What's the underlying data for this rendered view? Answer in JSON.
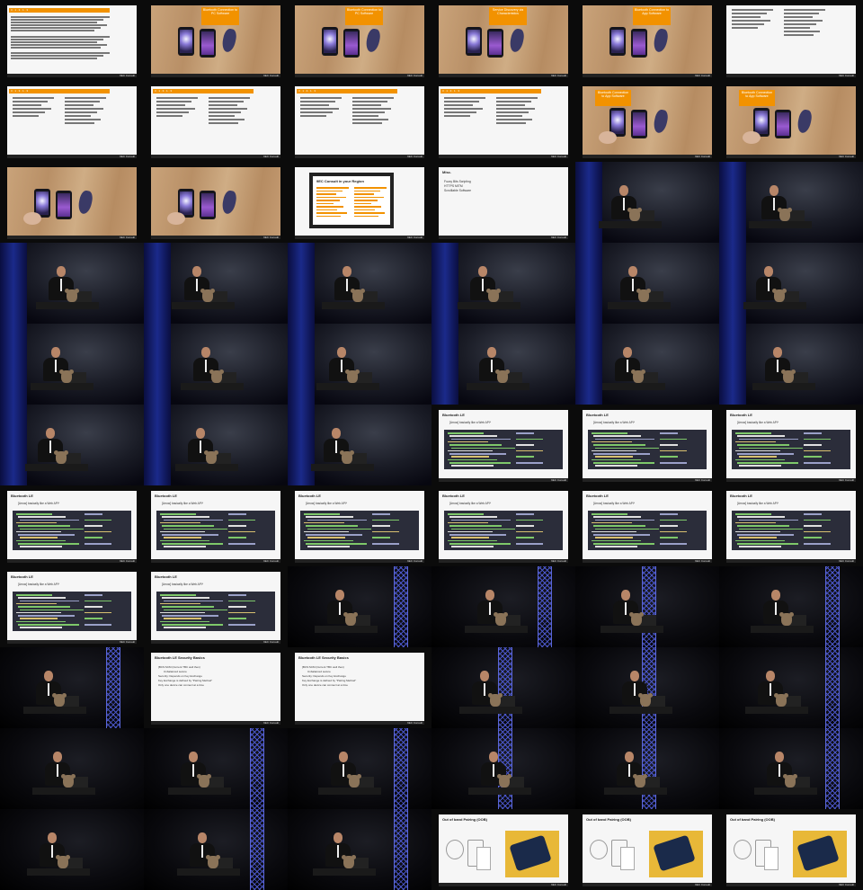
{
  "page": {
    "background": "#000000"
  },
  "labels": {
    "brand": "9EC Consult",
    "bluetooth_le_title": "Bluetooth LE",
    "bluetooth_le_subline": "[Arrow] basically like a Web API*",
    "bluetooth_security_title": "Bluetooth LE Security Basics",
    "bluetooth_security_items": [
      "[BCS:SCM (Current TBC well then)",
      "Unbalanced secure",
      "Security: Depends on Key Exchange",
      "Key Exchange is defined by \"Pairing Method\"",
      "Only one device can connect at a time"
    ],
    "misc_title": "Misc.",
    "misc_items": [
      "Fuzzy Bits Scripting",
      "HTTPS MITM",
      "Scrolllable Software"
    ],
    "contact_title": "9EC Consult in your Region",
    "oob_title": "Out of band Pairing (OOB)",
    "callout_1": "Bluetooth Connection to PC Software",
    "callout_2": "Bluetooth Connection to PC Software",
    "callout_3": "Service Discovery via Characteristics",
    "callout_4": "Bluetooth Connection to App Software",
    "callout_5": "Bluetooth Connection to App Software",
    "orange_heading": "3 · 1 · 3 · 1 · 3"
  },
  "thumbnails": [
    {
      "kind": "text-slide"
    },
    {
      "kind": "phones-slide",
      "callout": "callout_1"
    },
    {
      "kind": "phones-slide",
      "callout": "callout_2"
    },
    {
      "kind": "phones-slide",
      "callout": "callout_3"
    },
    {
      "kind": "phones-slide",
      "callout": "callout_4"
    },
    {
      "kind": "two-col-slide",
      "plain": true
    },
    {
      "kind": "two-col-slide"
    },
    {
      "kind": "two-col-slide"
    },
    {
      "kind": "two-col-slide"
    },
    {
      "kind": "two-col-slide"
    },
    {
      "kind": "phones-slide",
      "callout": "callout_5",
      "hand": true
    },
    {
      "kind": "phones-slide",
      "callout": "callout_5",
      "hand": true
    },
    {
      "kind": "phones-slide",
      "hand": true
    },
    {
      "kind": "phones-slide",
      "hand": true
    },
    {
      "kind": "contact-slide"
    },
    {
      "kind": "misc-slide"
    },
    {
      "kind": "speaker",
      "variant": "blue"
    },
    {
      "kind": "speaker",
      "variant": "blue"
    },
    {
      "kind": "speaker",
      "variant": "blue"
    },
    {
      "kind": "speaker",
      "variant": "blue"
    },
    {
      "kind": "speaker",
      "variant": "blue"
    },
    {
      "kind": "speaker",
      "variant": "blue"
    },
    {
      "kind": "speaker",
      "variant": "blue"
    },
    {
      "kind": "speaker",
      "variant": "blue"
    },
    {
      "kind": "speaker",
      "variant": "blue"
    },
    {
      "kind": "speaker",
      "variant": "blue"
    },
    {
      "kind": "speaker",
      "variant": "blue"
    },
    {
      "kind": "speaker",
      "variant": "blue"
    },
    {
      "kind": "speaker",
      "variant": "blue"
    },
    {
      "kind": "speaker",
      "variant": "blue"
    },
    {
      "kind": "speaker",
      "variant": "blue"
    },
    {
      "kind": "speaker",
      "variant": "blue"
    },
    {
      "kind": "speaker",
      "variant": "blue"
    },
    {
      "kind": "code-slide"
    },
    {
      "kind": "code-slide"
    },
    {
      "kind": "code-slide"
    },
    {
      "kind": "code-slide"
    },
    {
      "kind": "code-slide"
    },
    {
      "kind": "code-slide"
    },
    {
      "kind": "code-slide"
    },
    {
      "kind": "code-slide"
    },
    {
      "kind": "code-slide"
    },
    {
      "kind": "code-slide"
    },
    {
      "kind": "code-slide"
    },
    {
      "kind": "speaker",
      "variant": "truss",
      "truss": "right"
    },
    {
      "kind": "speaker",
      "variant": "truss",
      "truss": "right"
    },
    {
      "kind": "speaker",
      "variant": "truss",
      "truss": "center"
    },
    {
      "kind": "speaker",
      "variant": "truss",
      "truss": "right"
    },
    {
      "kind": "speaker",
      "variant": "truss",
      "truss": "right"
    },
    {
      "kind": "security-slide"
    },
    {
      "kind": "security-slide"
    },
    {
      "kind": "speaker",
      "variant": "truss",
      "truss": "center"
    },
    {
      "kind": "speaker",
      "variant": "truss",
      "truss": "center"
    },
    {
      "kind": "speaker",
      "variant": "truss",
      "truss": "right"
    },
    {
      "kind": "speaker",
      "variant": "truss",
      "truss": "none"
    },
    {
      "kind": "speaker",
      "variant": "truss",
      "truss": "right"
    },
    {
      "kind": "speaker",
      "variant": "truss",
      "truss": "right"
    },
    {
      "kind": "speaker",
      "variant": "truss",
      "truss": "center"
    },
    {
      "kind": "speaker",
      "variant": "truss",
      "truss": "center"
    },
    {
      "kind": "speaker",
      "variant": "truss",
      "truss": "right"
    },
    {
      "kind": "speaker",
      "variant": "truss",
      "truss": "none"
    },
    {
      "kind": "speaker",
      "variant": "truss",
      "truss": "right"
    },
    {
      "kind": "speaker",
      "variant": "truss",
      "truss": "right"
    },
    {
      "kind": "oob-slide"
    },
    {
      "kind": "oob-slide"
    },
    {
      "kind": "oob-slide"
    }
  ]
}
